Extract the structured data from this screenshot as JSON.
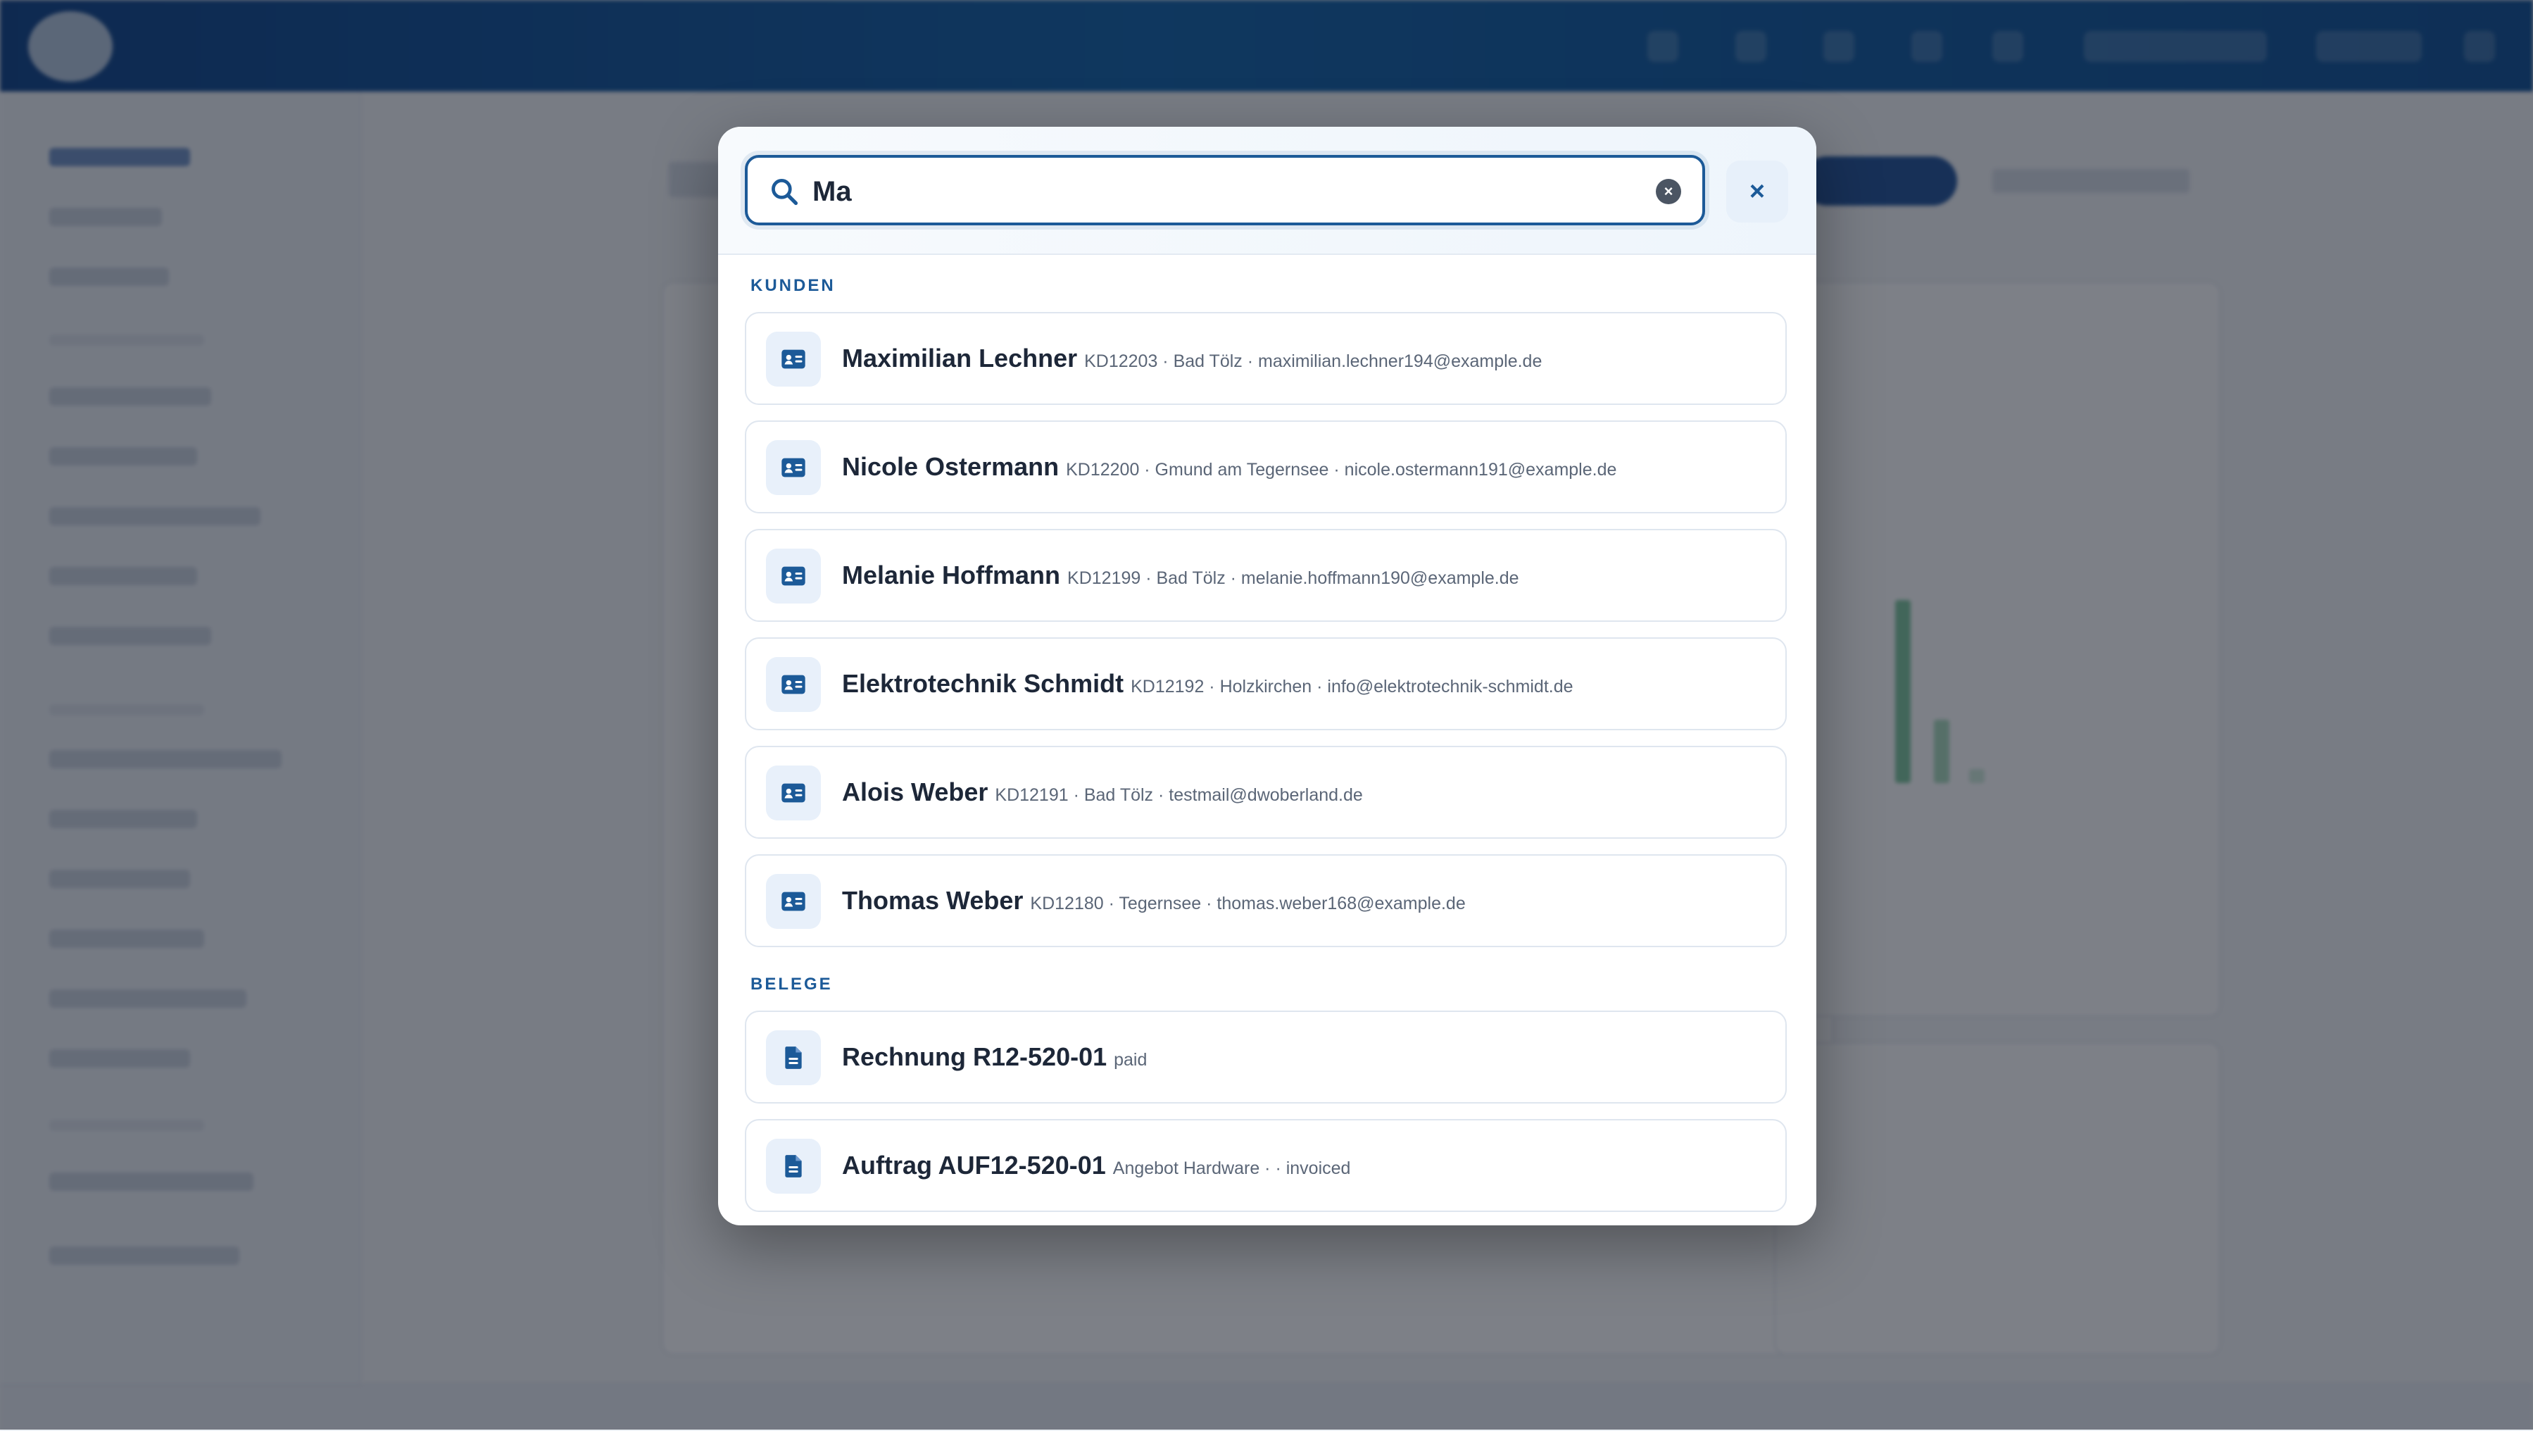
{
  "search": {
    "query": "Ma",
    "clear_label": "×",
    "close_label": "×"
  },
  "sections": {
    "customers_label": "KUNDEN",
    "documents_label": "BELEGE"
  },
  "customers": [
    {
      "name": "Maximilian Lechner",
      "meta": "KD12203 · Bad Tölz · maximilian.lechner194@example.de"
    },
    {
      "name": "Nicole Ostermann",
      "meta": "KD12200 · Gmund am Tegernsee · nicole.ostermann191@example.de"
    },
    {
      "name": "Melanie Hoffmann",
      "meta": "KD12199 · Bad Tölz · melanie.hoffmann190@example.de"
    },
    {
      "name": "Elektrotechnik Schmidt",
      "meta": "KD12192 · Holzkirchen · info@elektrotechnik-schmidt.de"
    },
    {
      "name": "Alois Weber",
      "meta": "KD12191 · Bad Tölz · testmail@dwoberland.de"
    },
    {
      "name": "Thomas Weber",
      "meta": "KD12180 · Tegernsee · thomas.weber168@example.de"
    }
  ],
  "documents": [
    {
      "title": "Rechnung R12-520-01",
      "meta": "paid"
    },
    {
      "title": "Auftrag AUF12-520-01",
      "meta": "Angebot Hardware · · invoiced"
    }
  ],
  "icons": {
    "customer": "contact-card-icon",
    "document": "file-icon",
    "search": "search-icon"
  },
  "colors": {
    "accent": "#1c5a98",
    "topbar": "#0b3f86"
  }
}
